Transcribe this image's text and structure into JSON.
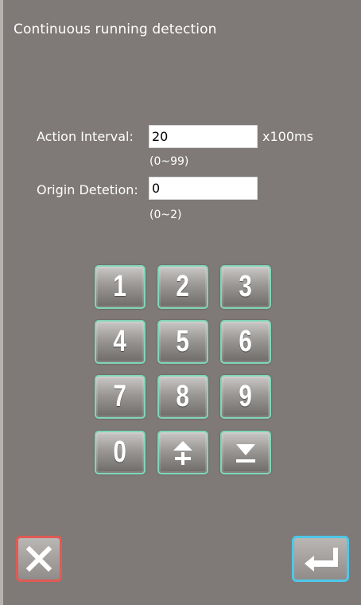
{
  "title": "Continuous running detection",
  "fields": [
    {
      "label": "Action Interval:",
      "value": "20",
      "unit": "x100ms",
      "range": "(0~99)"
    },
    {
      "label": "Origin Detetion:",
      "value": "0",
      "range": "(0~2)"
    }
  ],
  "keypad": {
    "keys": [
      "1",
      "2",
      "3",
      "4",
      "5",
      "6",
      "7",
      "8",
      "9",
      "0"
    ],
    "up_icon": "arrow-up-plus-icon",
    "down_icon": "arrow-down-minus-icon"
  },
  "actions": {
    "cancel_icon": "close-x-icon",
    "enter_icon": "enter-return-icon"
  },
  "colors": {
    "background": "#7f7a77",
    "key_border": "#7fd6b8",
    "cancel_border": "#e05a55",
    "enter_border": "#4fc7e8"
  }
}
